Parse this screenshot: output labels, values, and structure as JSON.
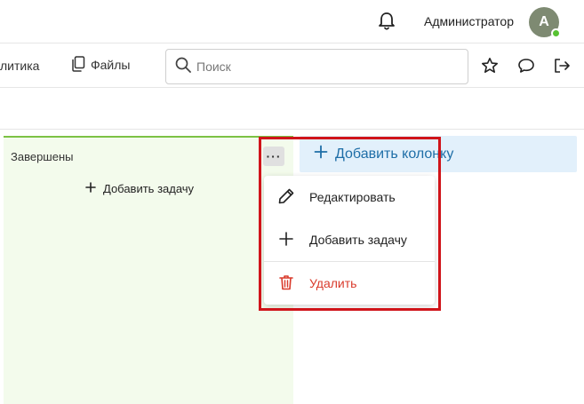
{
  "header": {
    "username": "Администратор",
    "avatar_letter": "A"
  },
  "nav": {
    "analytics_label": "литика",
    "files_label": "Файлы",
    "search_placeholder": "Поиск"
  },
  "board": {
    "column_title": "Завершены",
    "column_more": "···",
    "add_task_label": "Добавить задачу",
    "add_column_label": "Добавить колонку"
  },
  "context_menu": {
    "edit_label": "Редактировать",
    "add_task_label": "Добавить задачу",
    "delete_label": "Удалить"
  },
  "colors": {
    "column_accent": "#7cc244",
    "column_bg": "#f3fbec",
    "add_column_bg": "#e2f0fb",
    "add_column_text": "#1e6ea7",
    "delete_text": "#d93a2b",
    "highlight_border": "#d0141a",
    "avatar_bg": "#7e8a72",
    "status_online": "#57c232"
  }
}
